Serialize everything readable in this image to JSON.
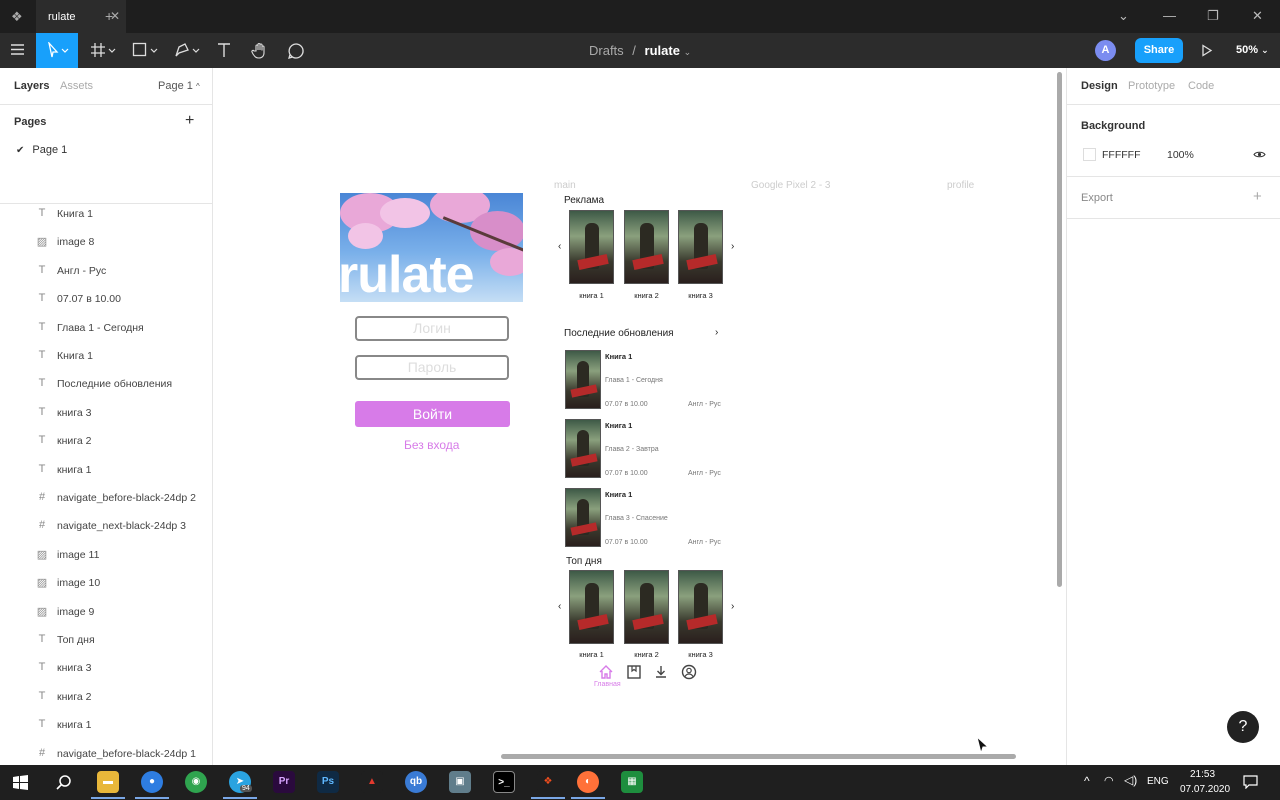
{
  "window": {
    "tab_title": "rulate"
  },
  "toolbar": {
    "breadcrumb_root": "Drafts",
    "breadcrumb_sep": "/",
    "file_name": "rulate",
    "avatar_letter": "A",
    "share_label": "Share",
    "zoom": "50%"
  },
  "left_panel": {
    "tab_layers": "Layers",
    "tab_assets": "Assets",
    "page_select": "Page 1",
    "pages_title": "Pages",
    "current_page": "Page 1",
    "layers": [
      {
        "type": "text",
        "name": "Книга 1"
      },
      {
        "type": "image",
        "name": "image 8"
      },
      {
        "type": "text",
        "name": "Англ - Рус"
      },
      {
        "type": "text",
        "name": "07.07 в 10.00"
      },
      {
        "type": "text",
        "name": "Глава 1 - Сегодня"
      },
      {
        "type": "text",
        "name": "Книга 1"
      },
      {
        "type": "text",
        "name": "Последние обновления"
      },
      {
        "type": "text",
        "name": "книга 3"
      },
      {
        "type": "text",
        "name": "книга 2"
      },
      {
        "type": "text",
        "name": "книга 1"
      },
      {
        "type": "frame",
        "name": "navigate_before-black-24dp 2"
      },
      {
        "type": "frame",
        "name": "navigate_next-black-24dp 3"
      },
      {
        "type": "image",
        "name": "image 11"
      },
      {
        "type": "image",
        "name": "image 10"
      },
      {
        "type": "image",
        "name": "image 9"
      },
      {
        "type": "text",
        "name": "Топ дня"
      },
      {
        "type": "text",
        "name": "книга 3"
      },
      {
        "type": "text",
        "name": "книга 2"
      },
      {
        "type": "text",
        "name": "книга 1"
      },
      {
        "type": "frame",
        "name": "navigate_before-black-24dp 1"
      }
    ]
  },
  "canvas": {
    "frame_labels": [
      "main",
      "Google Pixel 2 - 3",
      "profile"
    ],
    "login": {
      "hero_title": "rulate",
      "login_placeholder": "Логин",
      "password_placeholder": "Пароль",
      "login_button": "Войти",
      "guest_link": "Без входа"
    },
    "ads": {
      "title": "Реклама",
      "books": [
        "книга 1",
        "книга 2",
        "книга 3"
      ]
    },
    "updates": {
      "title": "Последние обновления",
      "items": [
        {
          "book": "Книга 1",
          "chapter": "Глава 1 - Сегодня",
          "date": "07.07 в 10.00",
          "lang": "Англ - Рус"
        },
        {
          "book": "Книга 1",
          "chapter": "Глава 2 - Завтра",
          "date": "07.07 в 10.00",
          "lang": "Англ - Рус"
        },
        {
          "book": "Книга 1",
          "chapter": "Глава 3 - Спасение",
          "date": "07.07 в 10.00",
          "lang": "Англ - Рус"
        }
      ]
    },
    "top": {
      "title": "Топ дня",
      "books": [
        "книга 1",
        "книга 2",
        "книга 3"
      ]
    },
    "bottom_nav": {
      "home_label": "Главная"
    }
  },
  "right_panel": {
    "tab_design": "Design",
    "tab_prototype": "Prototype",
    "tab_code": "Code",
    "background_title": "Background",
    "bg_hex": "FFFFFF",
    "bg_opacity": "100%",
    "export_title": "Export",
    "help": "?"
  },
  "taskbar": {
    "telegram_badge": "94",
    "lang": "ENG",
    "time": "21:53",
    "date": "07.07.2020"
  },
  "colors": {
    "accent": "#18a0fb",
    "brand_pink": "#d77be8",
    "dark": "#2c2c2c"
  }
}
